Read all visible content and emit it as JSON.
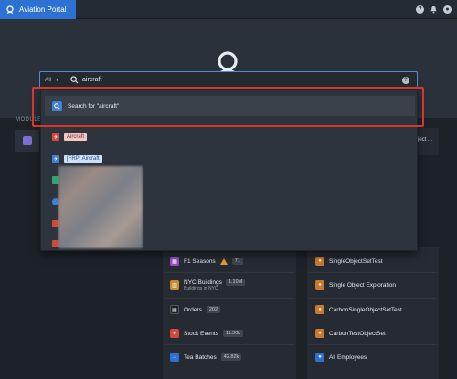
{
  "topbar": {
    "app_title": "Aviation Portal"
  },
  "search": {
    "scope": "All",
    "value": "aircraft"
  },
  "dropdown": {
    "search_for": "Search for \"aircraft\"",
    "results": [
      {
        "label": "Aircraft",
        "tag_color": "red"
      },
      {
        "label": "[FRP] Aircraft",
        "tag_color": "blue"
      }
    ]
  },
  "sections": {
    "modules_label": "MODULES",
    "right_card_text": "ject ..."
  },
  "left_list": [
    {
      "label": "F1 Seasons",
      "badge": "71",
      "warn": true
    },
    {
      "label": "NYC Buildings",
      "badge": "1.10M",
      "sub": "Buildings in NYC"
    },
    {
      "label": "Orders",
      "badge": "202"
    },
    {
      "label": "Stock Events",
      "badge": "11.30k"
    },
    {
      "label": "Tea Batches",
      "badge": "42.82k"
    }
  ],
  "right_list": [
    {
      "label": "SingleObjectSetTest"
    },
    {
      "label": "Single Object Exploration"
    },
    {
      "label": "CarbonSingleObjectSetTest"
    },
    {
      "label": "CarbonTestObjectSet"
    },
    {
      "label": "All Employees"
    }
  ],
  "colors": {
    "accent": "#2d72d2",
    "highlight": "#d9352b"
  }
}
